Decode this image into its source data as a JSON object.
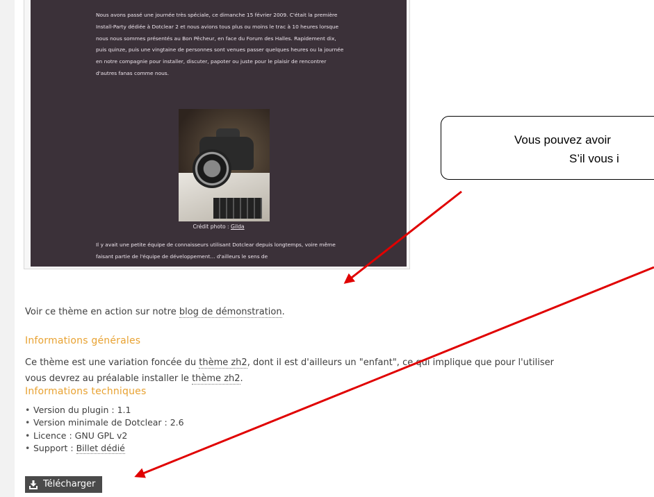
{
  "preview": {
    "paragraph1": "Nous avons passé une journée très spéciale, ce dimanche 15 février 2009. C'était la première Install-Party dédiée à Dotclear 2 et nous avions tous plus ou moins le trac à 10 heures lorsque nous nous sommes présentés au Bon Pêcheur, en face du Forum des Halles. Rapidement dix, puis quinze, puis une vingtaine de personnes sont venues passer quelques heures ou la journée en notre compagnie pour installer, discuter, papoter ou juste pour le plaisir de rencontrer d'autres fanas comme nous.",
    "caption_prefix": "Crédit photo : ",
    "caption_link": "Gilda",
    "paragraph2": "Il y avait une petite équipe de connaisseurs utilisant Dotclear depuis longtemps, voire même faisant partie de l'équipe de développement... d'ailleurs le sens de"
  },
  "demo": {
    "prefix": "Voir ce thème en action sur notre ",
    "link": "blog de démonstration",
    "suffix": "."
  },
  "general": {
    "title": "Informations générales",
    "line1_prefix": "Ce thème est une variation foncée du ",
    "line1_link": "thème zh2",
    "line1_suffix": ", dont il est d'ailleurs un \"enfant\", ce qui implique que pour l'utiliser",
    "line2_prefix": "vous devrez au préalable installer le ",
    "line2_link": "thème zh2",
    "line2_suffix": "."
  },
  "technical": {
    "title": "Informations techniques",
    "items": [
      {
        "label": "Version du plugin : ",
        "value": "1.1"
      },
      {
        "label": "Version minimale de Dotclear : ",
        "value": "2.6"
      },
      {
        "label": "Licence : ",
        "value": "GNU GPL v2"
      },
      {
        "label": "Support : ",
        "value": "Billet dédié"
      }
    ]
  },
  "download": {
    "label": "Télécharger",
    "icon": "download-icon"
  },
  "callout": {
    "line1": "Vous pouvez avoir",
    "line2": "S’il vous i"
  },
  "colors": {
    "accent": "#e8a232",
    "preview_bg": "#3b3139",
    "button_bg": "#4a4a4a",
    "arrow": "#e00000"
  }
}
